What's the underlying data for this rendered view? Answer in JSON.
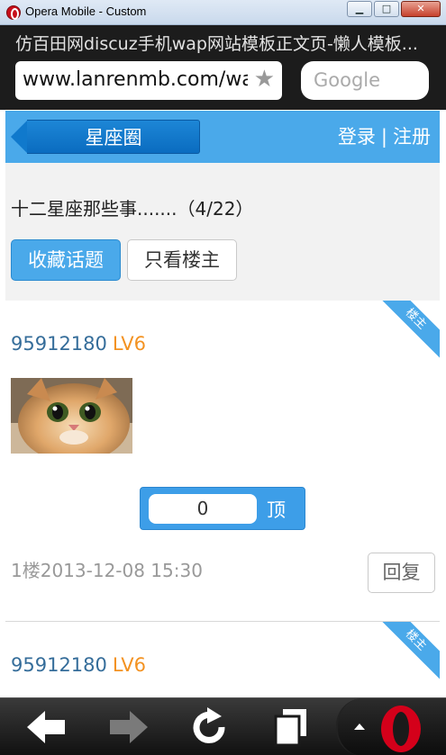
{
  "window": {
    "title": "Opera Mobile - Custom",
    "minimize": "▁",
    "maximize": "□",
    "close": "✕"
  },
  "browser": {
    "page_title": "仿百田网discuz手机wap网站模板正文页-懒人模板...",
    "url": "www.lanrenmb.com/wap",
    "search_placeholder": "Google"
  },
  "header": {
    "back_label": "星座圈",
    "login": "登录",
    "separator": "|",
    "register": "注册"
  },
  "topic": {
    "title": "十二星座那些事.......（4/22）",
    "favorite_button": "收藏话题",
    "owner_only_button": "只看楼主"
  },
  "posts": [
    {
      "badge": "楼主",
      "author": "95912180",
      "level": "LV6",
      "likes": "0",
      "like_label": "顶",
      "meta": "1楼2013-12-08 15:30",
      "reply_label": "回复"
    },
    {
      "badge": "楼主",
      "author": "95912180",
      "level": "LV6"
    }
  ],
  "toolbar": {
    "icons": [
      "back-arrow-icon",
      "forward-arrow-icon",
      "reload-icon",
      "tabs-icon",
      "opera-logo-icon"
    ]
  },
  "colors": {
    "accent": "#4aa9ea",
    "level": "#f39221",
    "author": "#356d9a",
    "chrome": "#1c1c1c"
  }
}
